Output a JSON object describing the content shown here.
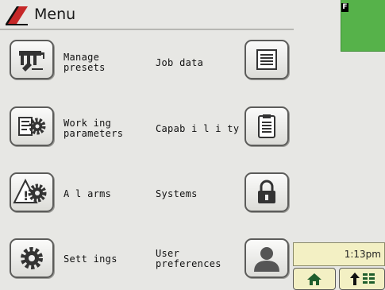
{
  "header": {
    "title": "Menu"
  },
  "menu": {
    "manage_presets": "Manage\npresets",
    "job_data": "Job data",
    "working_parameters": "Work ing\nparameters",
    "capability": "Capab i l i ty",
    "alarms": "A l arms",
    "systems": "Systems",
    "settings": "Sett ings",
    "user_preferences": "User\npreferences"
  },
  "status": {
    "f_indicator": "F",
    "clock": "1:13pm"
  },
  "colors": {
    "accent_red": "#c62828",
    "status_green": "#56b24a",
    "clock_bg": "#f3f0c4"
  },
  "icons": {
    "logo": "brand-logo-icon",
    "manage_presets": "presets-icon",
    "job_data": "document-icon",
    "working_parameters": "parameters-gear-icon",
    "capability": "clipboard-icon",
    "alarms": "alarm-gear-icon",
    "systems": "lock-icon",
    "settings": "gear-icon",
    "user_preferences": "user-icon",
    "home": "home-icon",
    "up_layers": "up-layers-icon"
  }
}
